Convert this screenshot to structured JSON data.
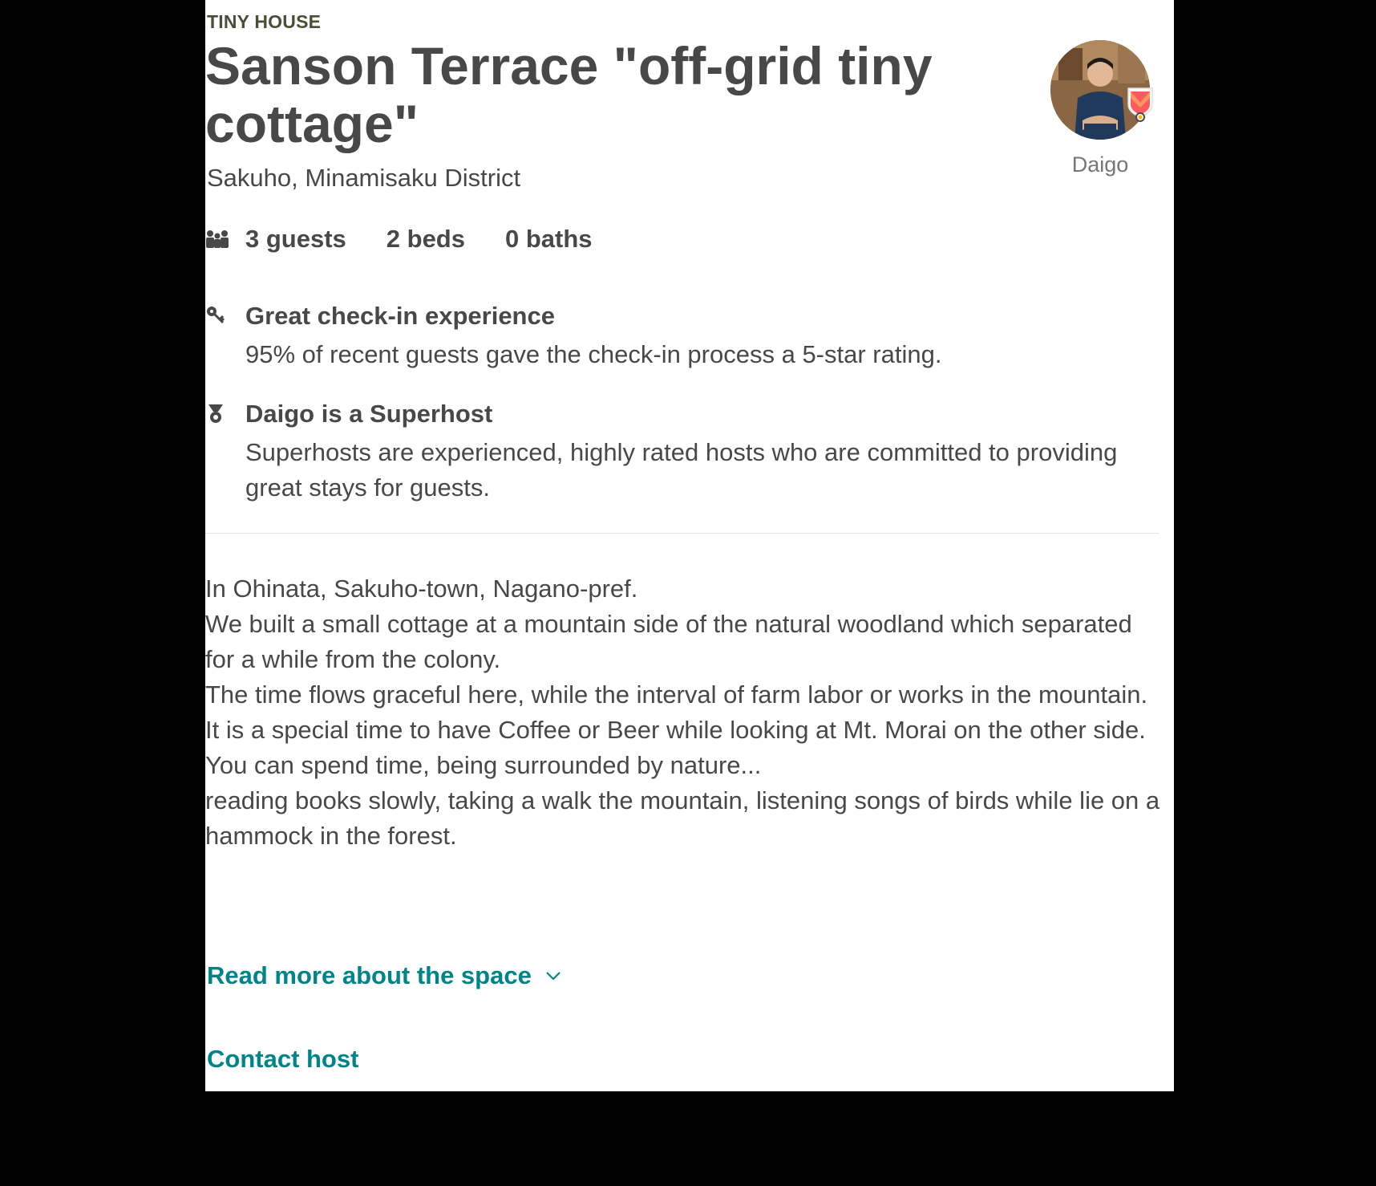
{
  "listing": {
    "category": "TINY HOUSE",
    "title": "Sanson Terrace \"off-grid tiny cottage\"",
    "location": "Sakuho, Minamisaku District"
  },
  "host": {
    "name": "Daigo",
    "avatar_icon": "host-avatar-photo",
    "badge_icon": "superhost-badge-icon"
  },
  "facts": {
    "icon": "guests-icon",
    "guests": "3 guests",
    "beds": "2 beds",
    "baths": "0 baths"
  },
  "highlights": [
    {
      "icon": "key-icon",
      "title": "Great check-in experience",
      "description": "95% of recent guests gave the check-in process a 5-star rating."
    },
    {
      "icon": "medal-icon",
      "title": "Daigo is a Superhost",
      "description": "Superhosts are experienced, highly rated hosts who are committed to providing great stays for guests."
    }
  ],
  "description": [
    "In Ohinata, Sakuho-town, Nagano-pref.",
    "We built a small cottage at a mountain side of the natural woodland which separated for a while from the colony.",
    "The time flows graceful here, while the interval of farm labor or works in the mountain.",
    "It is a special time to have Coffee or Beer while looking at Mt. Morai on the other side.",
    "You can spend time, being surrounded by nature...",
    "reading books slowly, taking a walk the mountain, listening songs of birds while lie on a hammock in the forest."
  ],
  "actions": {
    "read_more": "Read more about the space",
    "read_more_icon": "chevron-down-icon",
    "contact_host": "Contact host"
  },
  "colors": {
    "link": "#008489",
    "text": "#484848",
    "category": "#4a4f37",
    "muted": "#767676",
    "badge": "#ff5a5f"
  }
}
